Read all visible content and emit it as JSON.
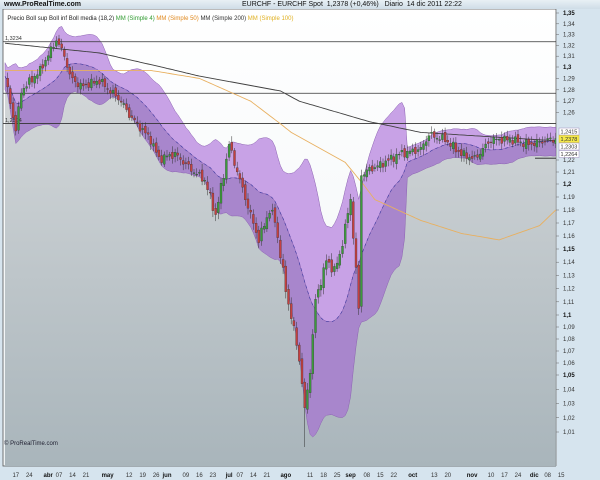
{
  "header": {
    "site": "www.ProRealTime.com",
    "instrument": "EURCHF - EURCHF Spot",
    "last": "1,2378 (+0,46%)",
    "period": "Diario",
    "datetime": "14 dic 2011 22:22"
  },
  "legend": [
    {
      "text": "Precio Boll sup Boll inf Boll media (18,2)",
      "color": "#222222"
    },
    {
      "text": "MM (Simple 4)",
      "color": "#2f9a2f"
    },
    {
      "text": "MM (Simple 50)",
      "color": "#e08a20"
    },
    {
      "text": "MM (Simple 200)",
      "color": "#333333"
    },
    {
      "text": "MM (Simple 100)",
      "color": "#e0b020"
    }
  ],
  "copyright": "© ProRealTime.com",
  "colors": {
    "up": "#3c9a3c",
    "down": "#c44040",
    "band_upper": "#c8a2e6",
    "band_lower": "#a886cc",
    "ma200": "#404040",
    "ma_orange": "#e8b060",
    "mid": "#3a3aa0"
  },
  "chart_data": {
    "type": "candlestick",
    "title": "EURCHF - EURCHF Spot",
    "ylim": [
      1.0,
      1.35
    ],
    "y_ticks": [
      "1,35",
      "1,34",
      "1,33",
      "1,32",
      "1,31",
      "1,3",
      "1,29",
      "1,28",
      "1,27",
      "1,26",
      "1,22",
      "1,21",
      "1,2",
      "1,19",
      "1,18",
      "1,17",
      "1,16",
      "1,15",
      "1,14",
      "1,13",
      "1,12",
      "1,11",
      "1,1",
      "1,09",
      "1,08",
      "1,07",
      "1,06",
      "1,05",
      "1,04",
      "1,03",
      "1,02",
      "1,01"
    ],
    "x_ticks": [
      {
        "label": "17",
        "day": 4
      },
      {
        "label": "24",
        "day": 9
      },
      {
        "label": "abr",
        "day": 16,
        "bold": true
      },
      {
        "label": "07",
        "day": 20
      },
      {
        "label": "14",
        "day": 25
      },
      {
        "label": "21",
        "day": 30
      },
      {
        "label": "may",
        "day": 38,
        "bold": true
      },
      {
        "label": "12",
        "day": 46
      },
      {
        "label": "19",
        "day": 51
      },
      {
        "label": "26",
        "day": 56
      },
      {
        "label": "jun",
        "day": 60,
        "bold": true
      },
      {
        "label": "09",
        "day": 67
      },
      {
        "label": "16",
        "day": 72
      },
      {
        "label": "23",
        "day": 77
      },
      {
        "label": "jul",
        "day": 83,
        "bold": true
      },
      {
        "label": "07",
        "day": 87
      },
      {
        "label": "14",
        "day": 92
      },
      {
        "label": "21",
        "day": 97
      },
      {
        "label": "ago",
        "day": 104,
        "bold": true
      },
      {
        "label": "11",
        "day": 113
      },
      {
        "label": "18",
        "day": 118
      },
      {
        "label": "25",
        "day": 123
      },
      {
        "label": "sep",
        "day": 128,
        "bold": true
      },
      {
        "label": "08",
        "day": 134
      },
      {
        "label": "15",
        "day": 139
      },
      {
        "label": "22",
        "day": 144
      },
      {
        "label": "oct",
        "day": 151,
        "bold": true
      },
      {
        "label": "13",
        "day": 159
      },
      {
        "label": "20",
        "day": 164
      },
      {
        "label": "nov",
        "day": 173,
        "bold": true
      },
      {
        "label": "10",
        "day": 180
      },
      {
        "label": "17",
        "day": 185
      },
      {
        "label": "24",
        "day": 190
      },
      {
        "label": "dic",
        "day": 196,
        "bold": true
      },
      {
        "label": "08",
        "day": 201
      },
      {
        "label": "15",
        "day": 206
      }
    ],
    "levels": [
      {
        "value": 1.3234,
        "label": "1,3234"
      },
      {
        "value": 1.277,
        "label": ""
      },
      {
        "value": 1.2504,
        "label": "1,2504"
      }
    ],
    "price_labels": [
      {
        "label": "1,2415",
        "highlight": false
      },
      {
        "label": "1,2378",
        "highlight": true
      },
      {
        "label": "1,2303",
        "highlight": false
      },
      {
        "label": "1,2264",
        "highlight": false
      }
    ],
    "close_keypoints": [
      [
        0,
        1.292
      ],
      [
        4,
        1.245
      ],
      [
        6,
        1.279
      ],
      [
        13,
        1.297
      ],
      [
        19,
        1.325
      ],
      [
        22,
        1.311
      ],
      [
        24,
        1.292
      ],
      [
        28,
        1.283
      ],
      [
        35,
        1.288
      ],
      [
        39,
        1.279
      ],
      [
        43,
        1.27
      ],
      [
        46,
        1.258
      ],
      [
        54,
        1.237
      ],
      [
        57,
        1.221
      ],
      [
        63,
        1.225
      ],
      [
        69,
        1.212
      ],
      [
        74,
        1.203
      ],
      [
        78,
        1.176
      ],
      [
        81,
        1.208
      ],
      [
        83,
        1.233
      ],
      [
        87,
        1.203
      ],
      [
        91,
        1.176
      ],
      [
        94,
        1.157
      ],
      [
        98,
        1.18
      ],
      [
        100,
        1.172
      ],
      [
        104,
        1.119
      ],
      [
        107,
        1.088
      ],
      [
        109,
        1.063
      ],
      [
        111,
        1.025
      ],
      [
        113,
        1.054
      ],
      [
        115,
        1.111
      ],
      [
        119,
        1.141
      ],
      [
        122,
        1.134
      ],
      [
        124,
        1.145
      ],
      [
        128,
        1.188
      ],
      [
        130,
        1.134
      ],
      [
        131,
        1.104
      ],
      [
        132,
        1.208
      ],
      [
        135,
        1.212
      ],
      [
        139,
        1.216
      ],
      [
        146,
        1.225
      ],
      [
        154,
        1.229
      ],
      [
        157,
        1.241
      ],
      [
        163,
        1.237
      ],
      [
        169,
        1.225
      ],
      [
        174,
        1.221
      ],
      [
        180,
        1.237
      ],
      [
        187,
        1.237
      ],
      [
        194,
        1.233
      ],
      [
        202,
        1.237
      ],
      [
        204,
        1.2378
      ]
    ],
    "ma200_keypoints": [
      [
        0,
        1.322
      ],
      [
        35,
        1.313
      ],
      [
        72,
        1.292
      ],
      [
        102,
        1.279
      ],
      [
        109,
        1.27
      ],
      [
        135,
        1.252
      ],
      [
        154,
        1.243
      ],
      [
        204,
        1.236
      ]
    ],
    "ma_orange_keypoints": [
      [
        0,
        1.297
      ],
      [
        54,
        1.297
      ],
      [
        72,
        1.29
      ],
      [
        91,
        1.27
      ],
      [
        106,
        1.243
      ],
      [
        126,
        1.218
      ],
      [
        137,
        1.188
      ],
      [
        154,
        1.172
      ],
      [
        169,
        1.162
      ],
      [
        183,
        1.157
      ],
      [
        198,
        1.168
      ],
      [
        204,
        1.18
      ]
    ],
    "bollinger": {
      "period": 18,
      "k": 2
    }
  }
}
